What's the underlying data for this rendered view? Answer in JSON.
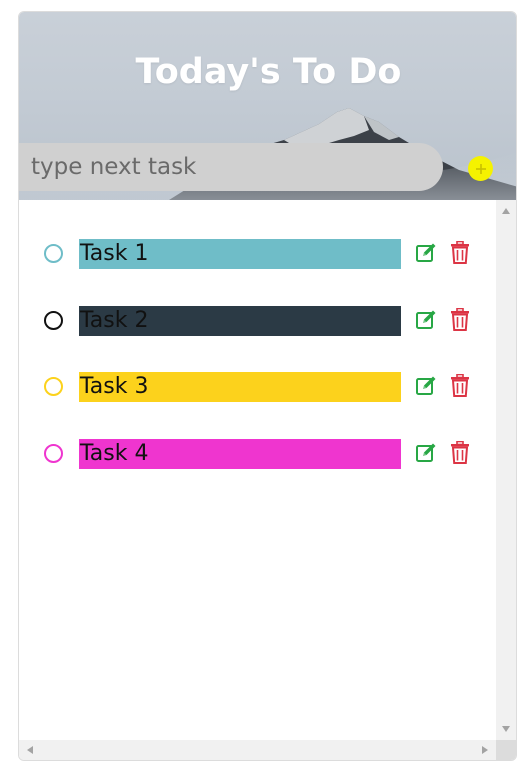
{
  "header": {
    "title": "Today's To Do"
  },
  "new_task": {
    "value": "",
    "placeholder": "type next task",
    "add_icon": "plus-icon",
    "add_color": "#f5f200"
  },
  "tasks": [
    {
      "label": "Task 1",
      "color": "#6fbdc8",
      "done": false
    },
    {
      "label": "Task 2",
      "color": "#2b3a45",
      "done": false
    },
    {
      "label": "Task 3",
      "color": "#fcd21c",
      "done": false
    },
    {
      "label": "Task 4",
      "color": "#ef35cf",
      "done": false
    }
  ],
  "icons": {
    "edit": "edit-icon",
    "edit_color": "#28a745",
    "delete": "trash-icon",
    "delete_color": "#dc3545"
  }
}
